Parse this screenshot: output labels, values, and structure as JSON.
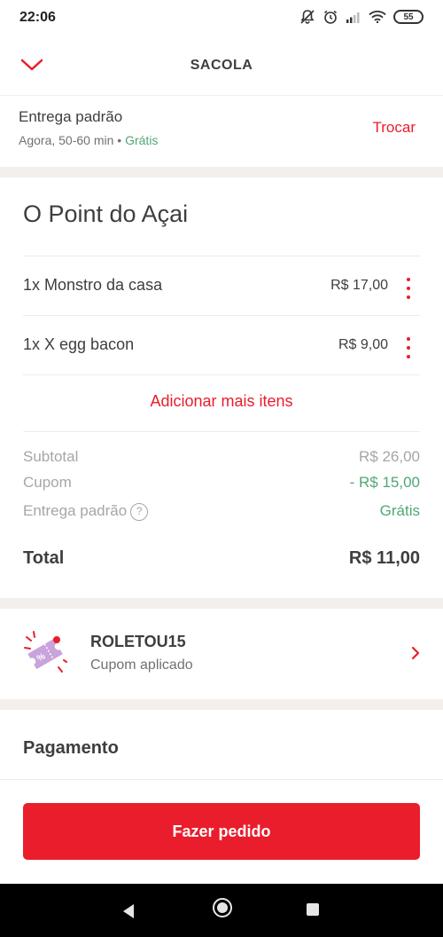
{
  "status_bar": {
    "time": "22:06",
    "battery": "55",
    "icons": [
      "notifications-off-icon",
      "alarm-icon",
      "signal-icon",
      "wifi-icon",
      "battery-icon"
    ]
  },
  "header": {
    "title": "SACOLA",
    "back_icon": "chevron-down-icon"
  },
  "delivery": {
    "title": "Entrega padrão",
    "time": "Agora, 50-60 min",
    "separator": "•",
    "fee": "Grátis",
    "change_label": "Trocar"
  },
  "restaurant": {
    "name": "O Point do Açai"
  },
  "items": [
    {
      "name": "1x  Monstro da casa",
      "price": "R$ 17,00"
    },
    {
      "name": "1x  X egg bacon",
      "price": "R$ 9,00"
    }
  ],
  "add_more_label": "Adicionar mais itens",
  "summary": {
    "subtotal_label": "Subtotal",
    "subtotal_value": "R$ 26,00",
    "coupon_label": "Cupom",
    "coupon_value": "- R$ 15,00",
    "delivery_label": "Entrega padrão",
    "delivery_help": "?",
    "delivery_value": "Grátis",
    "total_label": "Total",
    "total_value": "R$ 11,00"
  },
  "coupon": {
    "code": "ROLETOU15",
    "status": "Cupom aplicado",
    "icon": "coupon-ticket-icon"
  },
  "payment": {
    "title": "Pagamento"
  },
  "cta": {
    "label": "Fazer pedido"
  },
  "colors": {
    "brand_red": "#ea1d2c",
    "green": "#50a773",
    "text": "#3e3e3e",
    "muted": "#a6a6a6",
    "section_bg": "#f2efec"
  }
}
